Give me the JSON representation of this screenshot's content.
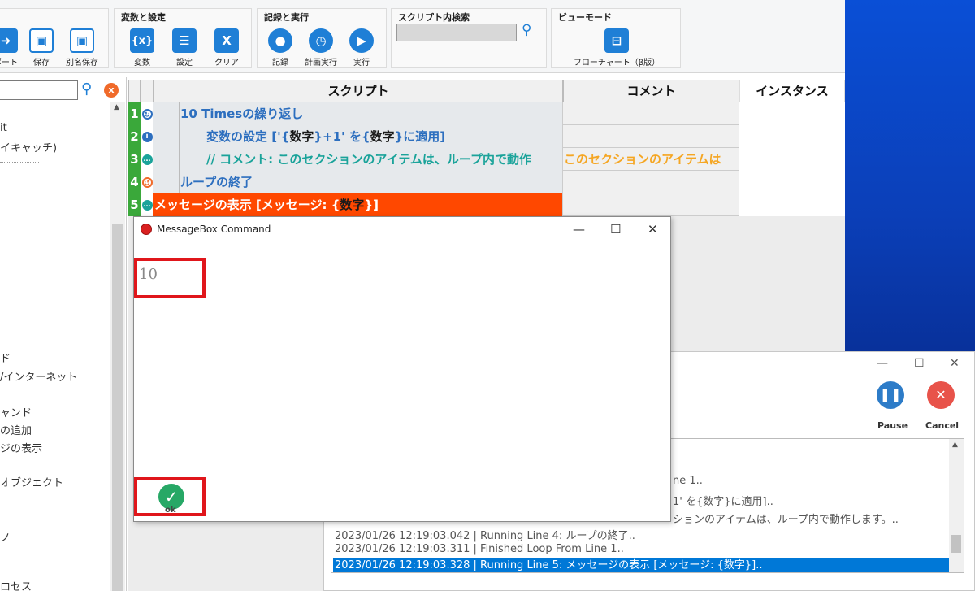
{
  "ribbon": {
    "partial_buttons": [
      {
        "label": "ポート",
        "icon": "arrow-right-icon"
      },
      {
        "label": "保存",
        "icon": "save-icon"
      },
      {
        "label": "別名保存",
        "icon": "save-as-icon"
      }
    ],
    "variables_group": {
      "title": "変数と設定",
      "buttons": [
        {
          "label": "変数",
          "glyph": "{x}"
        },
        {
          "label": "設定",
          "glyph": "☰"
        },
        {
          "label": "クリア",
          "glyph": "X"
        }
      ]
    },
    "record_group": {
      "title": "記録と実行",
      "buttons": [
        {
          "label": "記録",
          "icon": "record-icon"
        },
        {
          "label": "計画実行",
          "icon": "schedule-icon"
        },
        {
          "label": "実行",
          "icon": "play-icon"
        }
      ]
    },
    "search_group": {
      "title": "スクリプト内検索",
      "value": ""
    },
    "view_group": {
      "title": "ビューモード",
      "button_label": "フローチャート（β版）"
    }
  },
  "left_panel": {
    "search_value": "",
    "items": [
      "it",
      "イキャッチ)",
      "ド",
      "/インターネット",
      "ャンド",
      "の追加",
      "ジの表示",
      "オブジェクト",
      "ノ",
      "ロセス"
    ]
  },
  "grid": {
    "headers": {
      "script": "スクリプト",
      "comment": "コメント",
      "instance": "インスタンス"
    },
    "rows": [
      {
        "num": "1",
        "text": "10 Timesの繰り返し"
      },
      {
        "num": "2",
        "text_prefix": "変数の設定 ['{",
        "text_var1": "数字",
        "text_mid": "}+1' を{",
        "text_var2": "数字",
        "text_suffix": "}に適用]"
      },
      {
        "num": "3",
        "text": "// コメント: このセクションのアイテムは、ループ内で動作",
        "comment": "このセクションのアイテムは"
      },
      {
        "num": "4",
        "text": "ループの終了"
      },
      {
        "num": "5",
        "text_prefix": "メッセージの表示 [メッセージ: {",
        "text_var": "数字",
        "text_suffix": "}]"
      }
    ]
  },
  "message_box": {
    "title": "MessageBox Command",
    "value": "10",
    "ok_label": "ok"
  },
  "log_window": {
    "pause_label": "Pause",
    "cancel_label": "Cancel",
    "lines": [
      "ne 1..",
      "1' を{数字}に適用]..",
      "ションのアイテムは、ループ内で動作します。..",
      "2023/01/26 12:19:03.042 | Running Line 4: ループの終了..",
      "2023/01/26 12:19:03.311 | Finished Loop From Line 1..",
      "2023/01/26 12:19:03.328 | Running Line 5: メッセージの表示 [メッセージ: {数字}].."
    ]
  },
  "colors": {
    "accent_blue": "#1f7fd6",
    "line_number_green": "#3aa83a",
    "selected_row_orange": "#ff4800",
    "highlight_red": "#e0161b",
    "log_selection": "#0078d7"
  }
}
